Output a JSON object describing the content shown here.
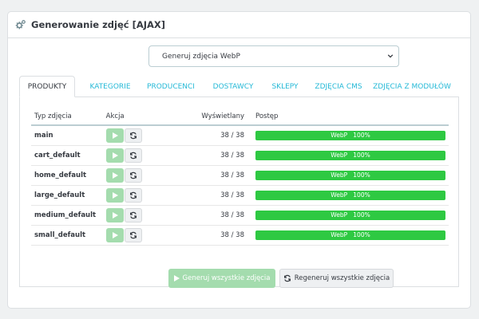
{
  "panel": {
    "title": "Generowanie zdjęć [AJAX]"
  },
  "format_select": {
    "value": "Generuj zdjęcia WebP"
  },
  "tabs": [
    {
      "label": "PRODUKTY",
      "active": true
    },
    {
      "label": "KATEGORIE"
    },
    {
      "label": "PRODUCENCI"
    },
    {
      "label": "DOSTAWCY"
    },
    {
      "label": "SKLEPY"
    },
    {
      "label": "ZDJĘCIA CMS"
    },
    {
      "label": "ZDJĘCIA Z MODUŁÓW"
    }
  ],
  "table": {
    "headers": {
      "type": "Typ zdjęcia",
      "action": "Akcja",
      "displayed": "Wyświetlany",
      "progress": "Postęp"
    },
    "rows": [
      {
        "type": "main",
        "displayed": "38 / 38",
        "progress_label": "WebP",
        "progress_pct": "100%",
        "progress_value": 100
      },
      {
        "type": "cart_default",
        "displayed": "38 / 38",
        "progress_label": "WebP",
        "progress_pct": "100%",
        "progress_value": 100
      },
      {
        "type": "home_default",
        "displayed": "38 / 38",
        "progress_label": "WebP",
        "progress_pct": "100%",
        "progress_value": 100
      },
      {
        "type": "large_default",
        "displayed": "38 / 38",
        "progress_label": "WebP",
        "progress_pct": "100%",
        "progress_value": 100
      },
      {
        "type": "medium_default",
        "displayed": "38 / 38",
        "progress_label": "WebP",
        "progress_pct": "100%",
        "progress_value": 100
      },
      {
        "type": "small_default",
        "displayed": "38 / 38",
        "progress_label": "WebP",
        "progress_pct": "100%",
        "progress_value": 100
      }
    ]
  },
  "buttons": {
    "generate_all": "Generuj wszystkie zdjęcia",
    "regenerate_all": "Regeneruj wszystkie zdjęcia"
  },
  "icons": {
    "header": "gears-icon",
    "play": "play-icon",
    "sync": "sync-icon",
    "select": "chevron-down-icon"
  },
  "colors": {
    "accent": "#25b9d7",
    "success": "#2ec942",
    "success_disabled": "#a4dcae"
  }
}
